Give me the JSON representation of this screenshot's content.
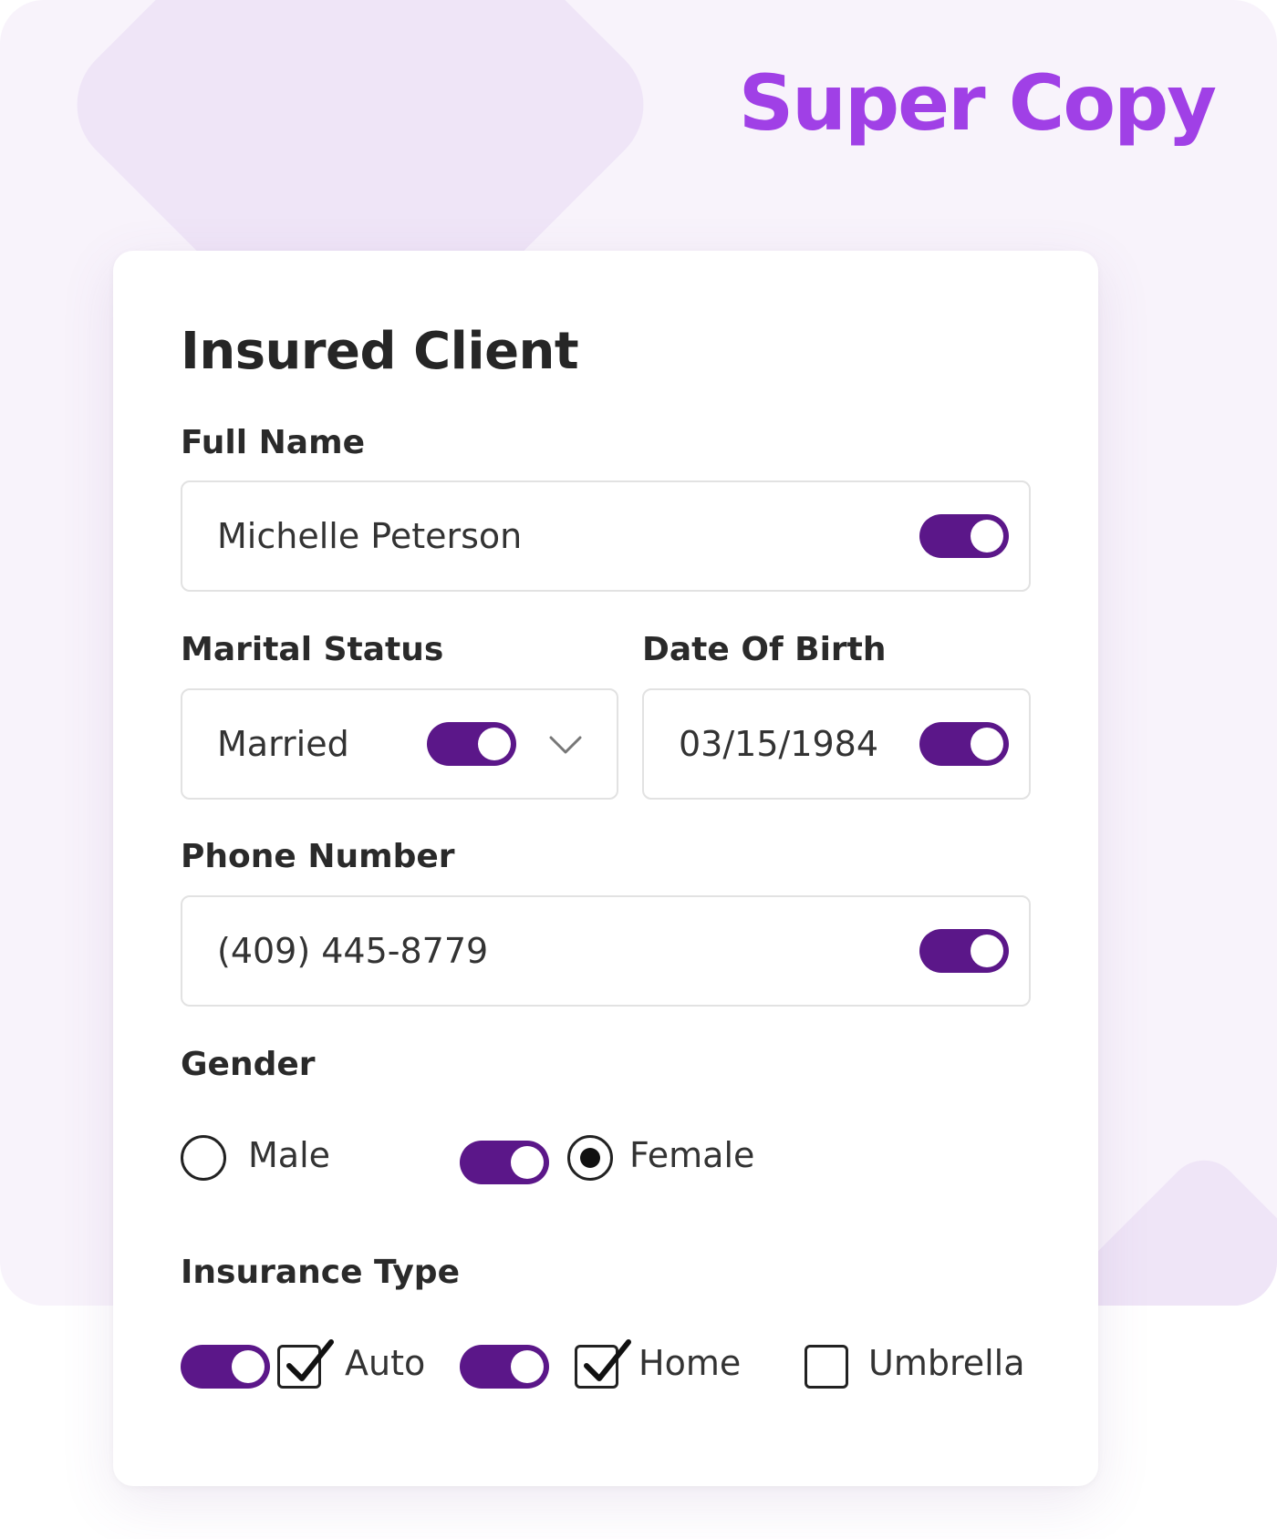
{
  "brand": {
    "name": "Super Copy",
    "color": "#a040e6"
  },
  "form": {
    "title": "Insured Client",
    "toggle_color": "#5b1789",
    "full_name": {
      "label": "Full Name",
      "value": "Michelle Peterson",
      "toggle_on": true
    },
    "marital_status": {
      "label": "Marital Status",
      "value": "Married",
      "toggle_on": true,
      "icon": "chevron-down-icon"
    },
    "date_of_birth": {
      "label": "Date Of Birth",
      "value": "03/15/1984",
      "toggle_on": true
    },
    "phone_number": {
      "label": "Phone Number",
      "value": "(409) 445-8779",
      "toggle_on": true
    },
    "gender": {
      "label": "Gender",
      "options": [
        {
          "label": "Male",
          "selected": false
        },
        {
          "label": "Female",
          "selected": true,
          "toggle_on": true
        }
      ]
    },
    "insurance_type": {
      "label": "Insurance Type",
      "options": [
        {
          "label": "Auto",
          "checked": true,
          "toggle_on": true
        },
        {
          "label": "Home",
          "checked": true,
          "toggle_on": true
        },
        {
          "label": "Umbrella",
          "checked": false
        }
      ]
    }
  }
}
